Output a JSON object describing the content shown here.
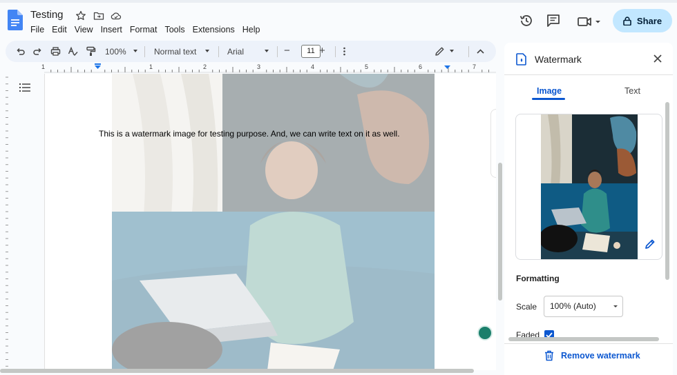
{
  "doc": {
    "title": "Testing",
    "menu": [
      "File",
      "Edit",
      "View",
      "Insert",
      "Format",
      "Tools",
      "Extensions",
      "Help"
    ]
  },
  "header": {
    "share_label": "Share"
  },
  "toolbar": {
    "zoom": "100%",
    "style": "Normal text",
    "font": "Arial",
    "font_size": "11",
    "minus": "−",
    "plus": "+"
  },
  "ruler": {
    "numbers": [
      "1",
      "1",
      "2",
      "3",
      "4",
      "5",
      "6",
      "7"
    ]
  },
  "page": {
    "body_text": "This is a watermark image for testing purpose. And, we can write text on it as well."
  },
  "panel": {
    "title": "Watermark",
    "tabs": [
      "Image",
      "Text"
    ],
    "active_tab": "Image",
    "formatting_label": "Formatting",
    "scale_label": "Scale",
    "scale_value": "100% (Auto)",
    "faded_label": "Faded",
    "faded_checked": true,
    "remove_label": "Remove watermark"
  },
  "colors": {
    "accent": "#0b57d0",
    "share_bg": "#c2e7ff",
    "toolbar_bg": "#edf2fa",
    "docs_blue": "#4285f4"
  }
}
